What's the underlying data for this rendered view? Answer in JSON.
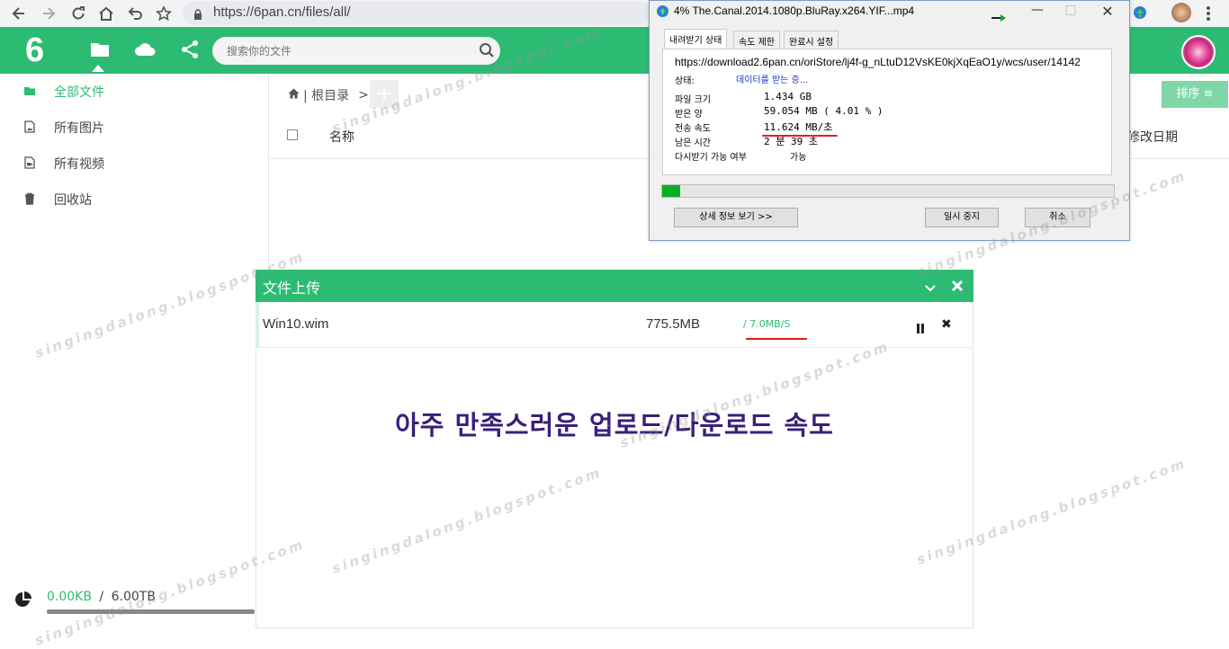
{
  "browser": {
    "url": "https://6pan.cn/files/all/"
  },
  "header": {
    "logo": "6",
    "search_placeholder": "搜索你的文件"
  },
  "sidebar": {
    "items": [
      {
        "label": "全部文件",
        "icon": "folder-icon",
        "active": true
      },
      {
        "label": "所有图片",
        "icon": "image-file-icon",
        "active": false
      },
      {
        "label": "所有视频",
        "icon": "video-file-icon",
        "active": false
      },
      {
        "label": "回收站",
        "icon": "trash-icon",
        "active": false
      }
    ],
    "storage_used": "0.00KB",
    "storage_sep": "/",
    "storage_total": "6.00TB"
  },
  "main": {
    "breadcrumb_root": "| 根目录",
    "breadcrumb_sep": ">",
    "add_label": "+",
    "sort_label": "排序",
    "columns": {
      "name": "名称",
      "date": "修改日期"
    }
  },
  "download_window": {
    "title": "4% The.Canal.2014.1080p.BluRay.x264.YIF...mp4",
    "tabs": [
      "내려받기 상태",
      "속도 제한",
      "완료시 설정"
    ],
    "url": "https://download2.6pan.cn/oriStore/lj4f-g_nLtuD12VsKE0kjXqEaO1y/wcs/user/14142",
    "status_label": "상태:",
    "status_value": "데이터를 받는 중...",
    "rows": [
      {
        "label": "파일 크기",
        "value": "1.434  GB"
      },
      {
        "label": "받은 양",
        "value": "59.054  MB  ( 4.01 % )"
      },
      {
        "label": "전송 속도",
        "value": "11.624  MB/초"
      },
      {
        "label": "남은 시간",
        "value": "2 분 39 초"
      }
    ],
    "resume_label": "다시받기 가능 여부",
    "resume_value": "가능",
    "progress": 0.04,
    "buttons": {
      "details": "상세 정보 보기 >>",
      "pause": "일시 중지",
      "cancel": "취소"
    }
  },
  "upload_panel": {
    "title": "文件上传",
    "file_name": "Win10.wim",
    "file_size": "775.5MB",
    "speed": "/  7.0MB/S",
    "caption": "아주 만족스러운 업로드/다운로드 속도"
  },
  "watermark": "singingdalong.blogspot.com",
  "colors": {
    "brand": "#2dbb74",
    "caption": "#3a1f76",
    "highlight": "#e02020"
  }
}
